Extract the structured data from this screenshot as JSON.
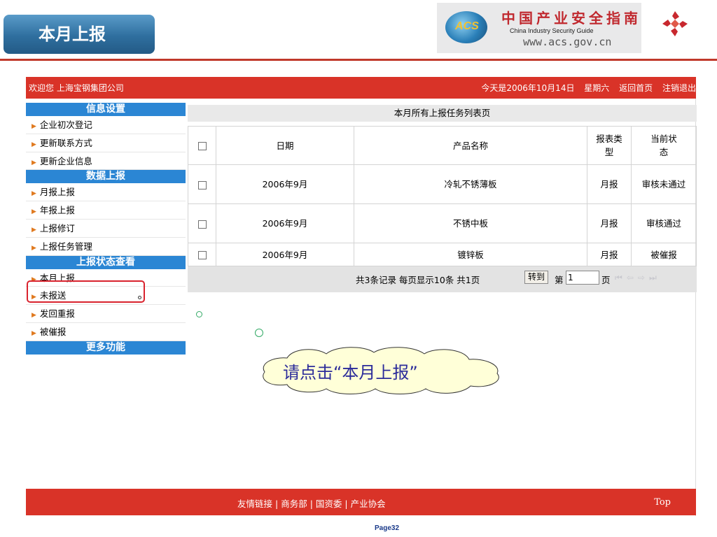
{
  "slide": {
    "title": "本月上报",
    "page_label": "Page32"
  },
  "logo": {
    "globe_text": "ACS",
    "cn_text": "中国产业安全指南",
    "en_text": "China  Industry  Security  Guide",
    "url_text": "www.acs.gov.cn"
  },
  "header": {
    "welcome": "欢迎您 上海宝钢集团公司",
    "date_text": "今天是2006年10月14日",
    "weekday": "星期六",
    "home_link": "返回首页",
    "logout_link": "注销退出"
  },
  "sidebar": {
    "groups": [
      {
        "title": "信息设置",
        "items": [
          "企业初次登记",
          "更新联系方式",
          "更新企业信息"
        ]
      },
      {
        "title": "数据上报",
        "items": [
          "月报上报",
          "年报上报",
          "上报修订",
          "上报任务管理"
        ]
      },
      {
        "title": "上报状态查看",
        "items": [
          "本月上报",
          "未报送",
          "发回重报",
          "被催报"
        ]
      },
      {
        "title": "更多功能",
        "items": []
      }
    ]
  },
  "content": {
    "title": "本月所有上报任务列表页",
    "columns": [
      "日期",
      "产品名称",
      "报表类型",
      "当前状态"
    ],
    "column_display": [
      "日期",
      "产品名称",
      "报表类\n型",
      "当前状\n态"
    ],
    "rows": [
      {
        "date": "2006年9月",
        "product": "冷轧不锈薄板",
        "type": "月报",
        "status": "审核未通过"
      },
      {
        "date": "2006年9月",
        "product": "不锈中板",
        "type": "月报",
        "status": "审核通过"
      },
      {
        "date": "2006年9月",
        "product": "镀锌板",
        "type": "月报",
        "status": "被催报"
      }
    ],
    "pager": {
      "summary": "共3条记录  每页显示10条  共1页",
      "goto_label": "转到",
      "page_prefix": "第",
      "page_value": "1",
      "page_suffix": "页",
      "nav_icons": [
        "first-icon",
        "prev-icon",
        "next-icon",
        "last-icon"
      ]
    }
  },
  "footer": {
    "links": [
      "友情链接",
      "商务部",
      "国资委",
      "产业协会"
    ],
    "top_link": "Top"
  },
  "annotation": {
    "text": "请点击“本月上报”"
  },
  "colors": {
    "header_red": "#d93328",
    "side_blue": "#2b86d4",
    "highlight_red": "#d9232e",
    "title_blue": "#2f6f9f"
  }
}
